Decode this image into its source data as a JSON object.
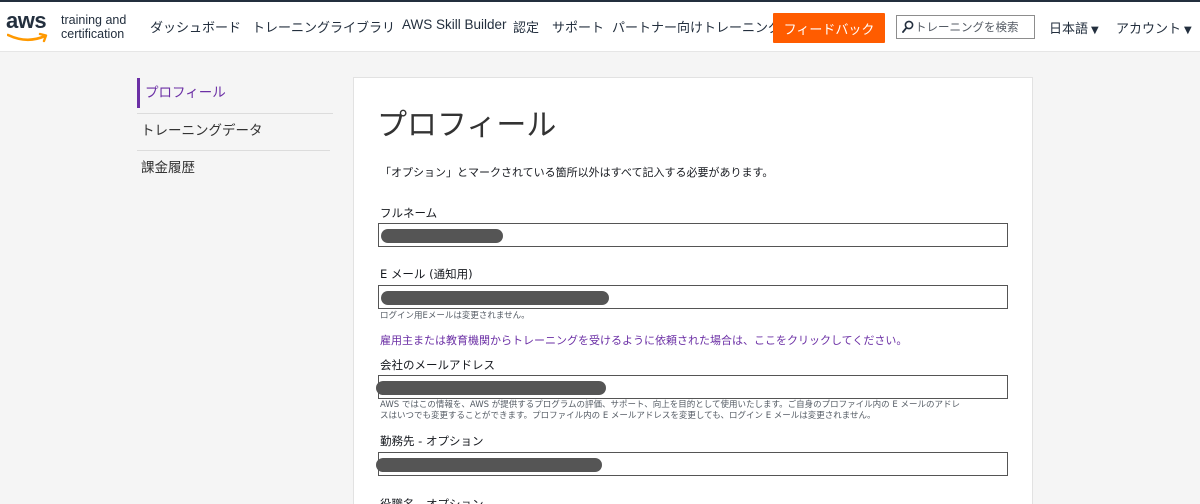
{
  "header": {
    "logo": {
      "brand": "aws",
      "line1": "training and",
      "line2": "certification"
    },
    "nav": {
      "dashboard": "ダッシュボード",
      "library": "トレーニングライブラリ",
      "skill_builder": "AWS Skill Builder",
      "certification": "認定",
      "support": "サポート",
      "partner": "パートナー向けトレーニング"
    },
    "feedback_label": "フィードバック",
    "search_placeholder": "トレーニングを検索",
    "language": "日本語",
    "account": "アカウント",
    "caret": "▼"
  },
  "sidebar": {
    "profile": "プロフィール",
    "training_data": "トレーニングデータ",
    "billing": "課金履歴"
  },
  "form": {
    "title": "プロフィール",
    "instructions": "「オプション」とマークされている箇所以外はすべて記入する必要があります。",
    "fullname_label": "フルネーム",
    "email_label": "E メール (通知用)",
    "email_hint": "ログイン用Eメールは変更されません。",
    "employer_link": "雇用主または教育機関からトレーニングを受けるように依頼された場合は、ここをクリックしてください。",
    "company_email_label": "会社のメールアドレス",
    "company_email_hint_1": "AWS ではこの情報を、AWS が提供するプログラムの評価、サポート、向上を目的として使用いたします。ご自身のプロファイル内の E メールのアドレ",
    "company_email_hint_2": "スはいつでも変更することができます。プロファイル内の E メールアドレスを変更しても、ログイン E メールは変更されません。",
    "workplace_label": "勤務先 - オプション",
    "job_title_label": "役職名 - オプション"
  },
  "colors": {
    "accent": "#ff5c00",
    "link": "#6b2fa5",
    "navy": "#232f3e"
  }
}
